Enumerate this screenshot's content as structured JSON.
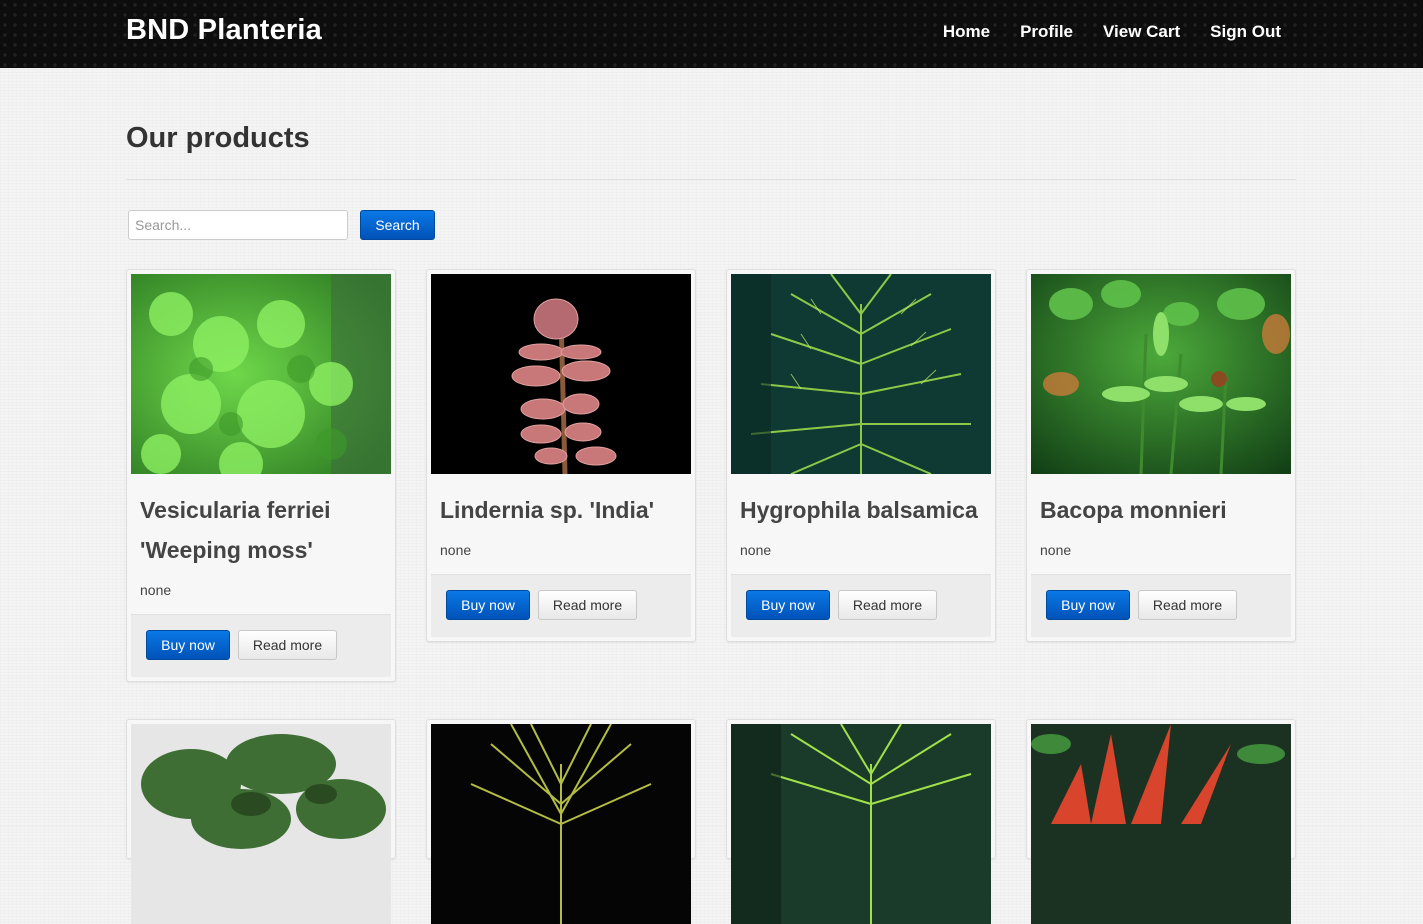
{
  "brand": "BND Planteria",
  "nav": [
    "Home",
    "Profile",
    "View Cart",
    "Sign Out"
  ],
  "page_title": "Our products",
  "search": {
    "placeholder": "Search...",
    "button": "Search"
  },
  "buttons": {
    "buy": "Buy now",
    "more": "Read more"
  },
  "products": [
    {
      "name": "Vesicularia ferriei 'Weeping moss'",
      "desc": "none"
    },
    {
      "name": "Lindernia sp. 'India'",
      "desc": "none"
    },
    {
      "name": "Hygrophila balsamica",
      "desc": "none"
    },
    {
      "name": "Bacopa monnieri",
      "desc": "none"
    }
  ],
  "colors": {
    "nav_bg": "#0d0d0d",
    "primary": "#0a6fdb"
  }
}
